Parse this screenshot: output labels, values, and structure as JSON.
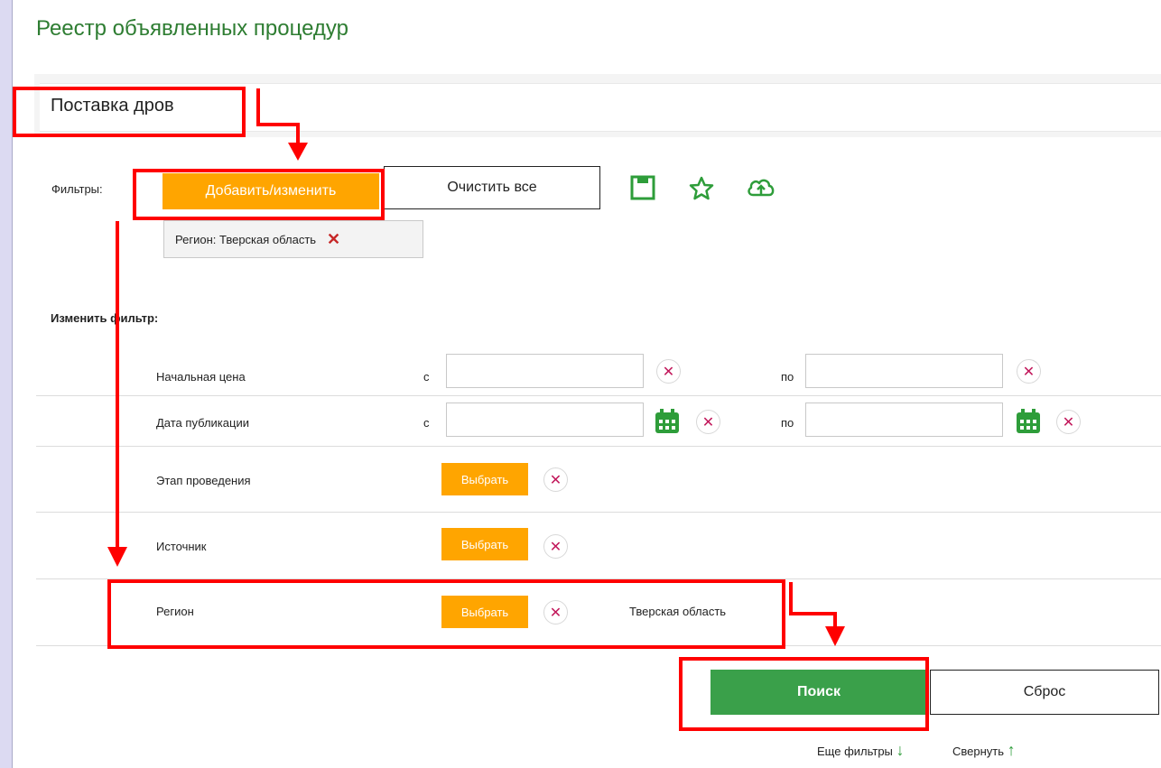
{
  "page_title": "Реестр объявленных процедур",
  "search": {
    "value": "Поставка дров"
  },
  "filters": {
    "label": "Фильтры:",
    "add_button": "Добавить/изменить",
    "clear_all_button": "Очистить все",
    "chip_text": "Регион: Тверская область",
    "chip_close": "✕",
    "icons": [
      "save-icon",
      "star-icon",
      "cloud-upload-icon"
    ]
  },
  "edit_filter": {
    "heading": "Изменить фильтр:",
    "rows": [
      {
        "label": "Начальная цена",
        "from": "с",
        "to": "по"
      },
      {
        "label": "Дата публикации",
        "from": "с",
        "to": "по"
      },
      {
        "label": "Этап проведения",
        "select": "Выбрать"
      },
      {
        "label": "Источник",
        "select": "Выбрать"
      },
      {
        "label": "Регион",
        "select": "Выбрать",
        "value": "Тверская область"
      }
    ],
    "clear_symbol": "✕"
  },
  "actions": {
    "search_button": "Поиск",
    "reset_button": "Сброс",
    "more_filters": "Еще фильтры",
    "collapse": "Свернуть",
    "down_arrow": "↓",
    "up_arrow": "↑"
  },
  "colors": {
    "accent_orange": "#ffa500",
    "accent_green": "#3aa04a",
    "title_green": "#2e7d32",
    "annotation_red": "#ff0000",
    "clear_pink": "#c2185b"
  }
}
